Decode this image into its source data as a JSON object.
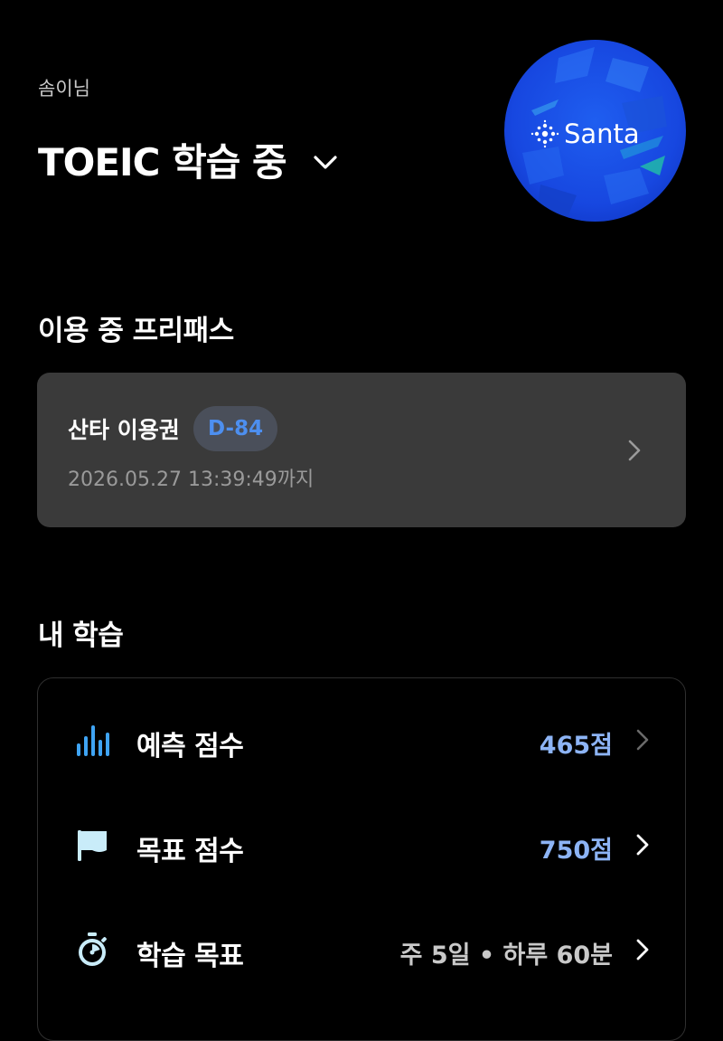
{
  "header": {
    "user_name": "솜이님",
    "title": "TOEIC 학습 중",
    "avatar_text": "Santa"
  },
  "freepass": {
    "section_title": "이용 중 프리패스",
    "pass_name": "산타 이용권",
    "dday": "D-84",
    "expiry": "2026.05.27 13:39:49까지"
  },
  "my_study": {
    "section_title": "내 학습",
    "rows": [
      {
        "label": "예측 점수",
        "value": "465점",
        "icon": "bar-chart-icon"
      },
      {
        "label": "목표 점수",
        "value": "750점",
        "icon": "flag-icon"
      },
      {
        "label": "학습 목표",
        "value": "주 5일 • 하루 60분",
        "icon": "stopwatch-icon"
      }
    ]
  },
  "colors": {
    "background": "#000000",
    "card": "#3a3a3a",
    "accent_blue": "#4d8ff0",
    "score_blue": "#8db4f5",
    "icon_blue": "#3fa4f4",
    "icon_light": "#c9ecf9"
  }
}
